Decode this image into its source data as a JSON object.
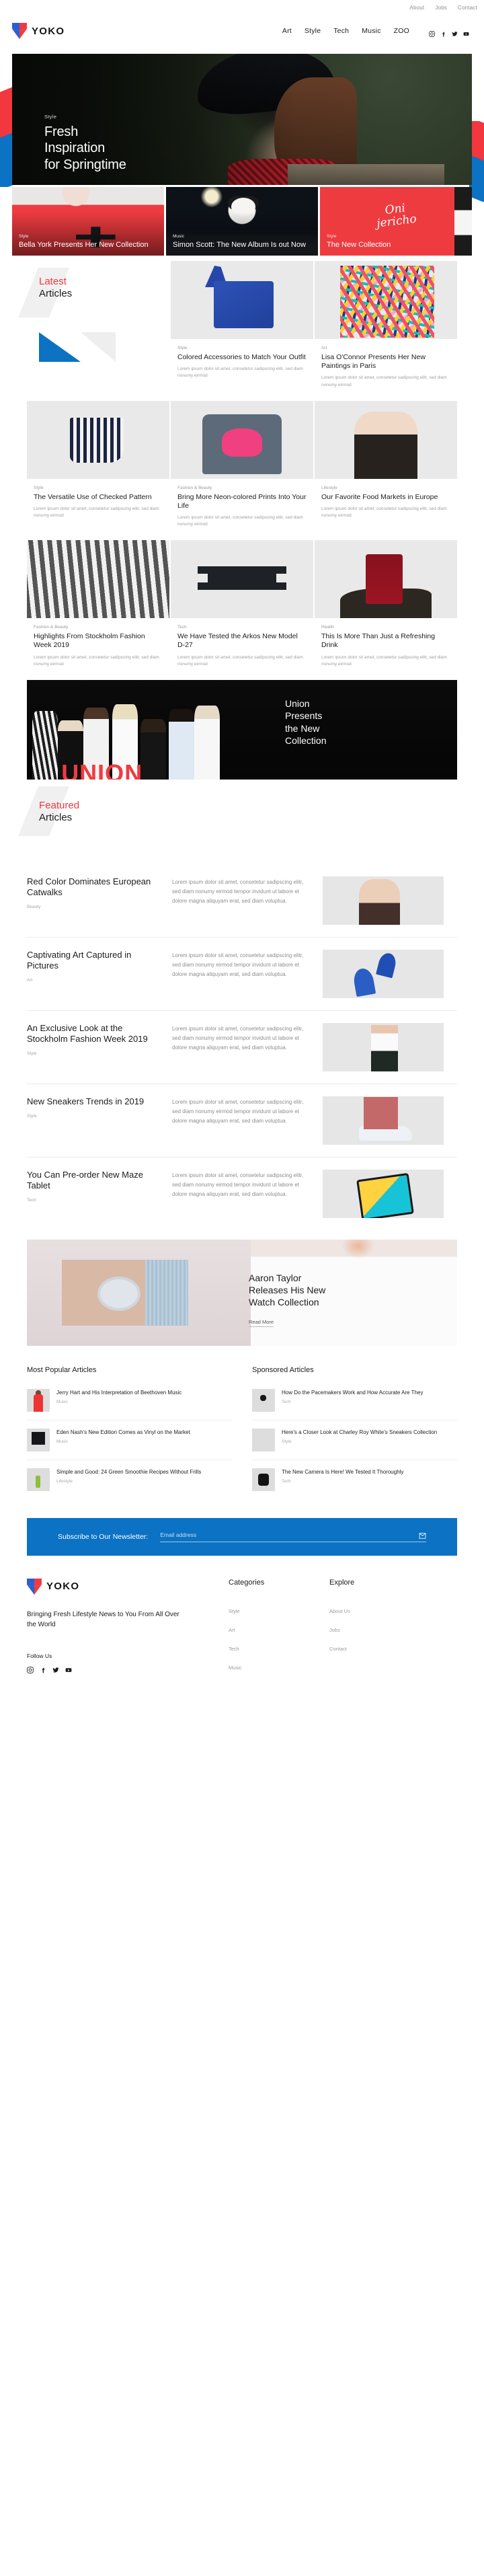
{
  "topbar": {
    "links": [
      "About",
      "Jobs",
      "Contact"
    ]
  },
  "header": {
    "brand": "YOKO",
    "nav": [
      "Art",
      "Style",
      "Tech",
      "Music",
      "ZOO"
    ],
    "socials": [
      "instagram-icon",
      "facebook-icon",
      "twitter-icon",
      "youtube-icon"
    ]
  },
  "hero": {
    "kicker": "Style",
    "title_line1": "Fresh",
    "title_line2": "Inspiration",
    "title_line3": "for Springtime",
    "cards": [
      {
        "kicker": "Style",
        "title": "Bella York Presents Her New Collection"
      },
      {
        "kicker": "Music",
        "title": "Simon Scott: The New Album Is out Now"
      },
      {
        "kicker": "Style",
        "title": "The New Collection",
        "script": "Oni\njericho"
      }
    ]
  },
  "latest": {
    "heading_red": "Latest",
    "heading_dark": "Articles",
    "excerpt": "Lorem ipsum dolor sit amet, consetetur sadipscing elitr, sed diam nonumy eirmod",
    "cards": [
      {
        "kicker": "Style",
        "title": "Colored Accessories to Match Your Outfit"
      },
      {
        "kicker": "Art",
        "title": "Lisa O'Connor Presents Her New Paintings in Paris"
      },
      {
        "kicker": "Style",
        "title": "The Versatile Use of Checked Pattern"
      },
      {
        "kicker": "Fashion & Beauty",
        "title": "Bring More Neon-colored Prints Into Your Life"
      },
      {
        "kicker": "Lifestyle",
        "title": "Our Favorite Food Markets in Europe"
      },
      {
        "kicker": "Fashion & Beauty",
        "title": "Highlights From Stockholm Fashion Week 2019"
      },
      {
        "kicker": "Tech",
        "title": "We Have Tested the Arkos New Model D-27"
      },
      {
        "kicker": "Health",
        "title": "This Is More Than Just a Refreshing Drink"
      }
    ]
  },
  "union": {
    "word": "UNION",
    "title_line1": "Union",
    "title_line2": "Presents",
    "title_line3": "the New",
    "title_line4": "Collection"
  },
  "featured": {
    "heading_red": "Featured",
    "heading_dark": "Articles",
    "excerpt": "Lorem ipsum dolor sit amet, consetetur sadipscing elitr, sed diam nonumy eirmod tempor invidunt ut labore et dolore magna aliquyam erat, sed diam voluptua.",
    "rows": [
      {
        "title": "Red Color Dominates European Catwalks",
        "kicker": "Beauty"
      },
      {
        "title": "Captivating Art Captured in Pictures",
        "kicker": "Art"
      },
      {
        "title": "An Exclusive Look at the Stockholm Fashion Week 2019",
        "kicker": "Style"
      },
      {
        "title": "New Sneakers Trends in 2019",
        "kicker": "Style"
      },
      {
        "title": "You Can Pre-order New Maze Tablet",
        "kicker": "Tech"
      }
    ]
  },
  "promo": {
    "title_line1": "Aaron Taylor",
    "title_line2": "Releases His New",
    "title_line3": "Watch Collection",
    "button": "Read More"
  },
  "popular": {
    "heading": "Most Popular Articles",
    "items": [
      {
        "title": "Jerry Hart and His Interpretation of Beethoven Music",
        "kicker": "Music"
      },
      {
        "title": "Eden Nash's New Edition Comes as Vinyl on the Market",
        "kicker": "Music"
      },
      {
        "title": "Simple and Good: 24 Green Smoothie Recipes Without Frills",
        "kicker": "Lifestyle"
      }
    ]
  },
  "sponsored": {
    "heading": "Sponsored Articles",
    "items": [
      {
        "title": "How Do the Pacemakers Work and How Accurate Are They",
        "kicker": "Tech"
      },
      {
        "title": "Here's a Closer Look at Charley Roy White's Sneakers Collection",
        "kicker": "Style"
      },
      {
        "title": "The New Camera Is Here! We Tested It Thoroughly",
        "kicker": "Tech"
      }
    ]
  },
  "newsletter": {
    "label": "Subscribe to Our Newsletter:",
    "placeholder": "Email address",
    "value": ""
  },
  "footer": {
    "brand": "YOKO",
    "tagline": "Bringing Fresh Lifestyle News to You From All Over the World",
    "follow_label": "Follow Us",
    "socials": [
      "instagram-icon",
      "facebook-icon",
      "twitter-icon",
      "youtube-icon"
    ],
    "categories_heading": "Categories",
    "categories": [
      "Style",
      "Art",
      "Tech",
      "Music"
    ],
    "explore_heading": "Explore",
    "explore": [
      "About Us",
      "Jobs",
      "Contact"
    ]
  },
  "colors": {
    "red": "#f2373f",
    "blue": "#0b72c4",
    "dark": "#1c1c1c"
  }
}
